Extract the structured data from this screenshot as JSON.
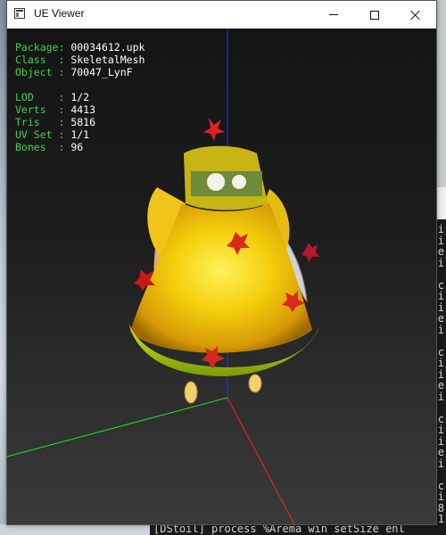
{
  "window": {
    "title": "UE Viewer",
    "icon": "app-window-icon",
    "controls": [
      "minimize",
      "maximize",
      "close"
    ]
  },
  "info": {
    "package_label": "Package",
    "package_value": "00034612.upk",
    "class_label": "Class",
    "class_value": "SkeletalMesh",
    "object_label": "Object",
    "object_value": "70047_LynF",
    "lod_label": "LOD",
    "lod_value": "1/2",
    "verts_label": "Verts",
    "verts_value": "4413",
    "tris_label": "Tris",
    "tris_value": "5816",
    "uvset_label": "UV Set",
    "uvset_value": "1/1",
    "bones_label": "Bones",
    "bones_value": "96"
  },
  "colors": {
    "label_green": "#3fd24a",
    "axis_x": "#ff2020",
    "axis_y": "#20e020",
    "axis_z": "#2030ff",
    "dress_yellow": "#f6d410"
  },
  "background_console": {
    "bottom_line": "[DStoil] process  %Arema win setSize  enl",
    "right_edge_chars": [
      "ti",
      "ti",
      "ce",
      "li",
      "",
      "oc",
      "ti",
      "ti",
      "ce",
      "li",
      "",
      "oc",
      "ti",
      "ti",
      "ce",
      "li",
      "",
      "oc",
      "ti",
      "ti",
      "ce",
      "li",
      "",
      "oc",
      "ti",
      "8",
      "1"
    ]
  }
}
